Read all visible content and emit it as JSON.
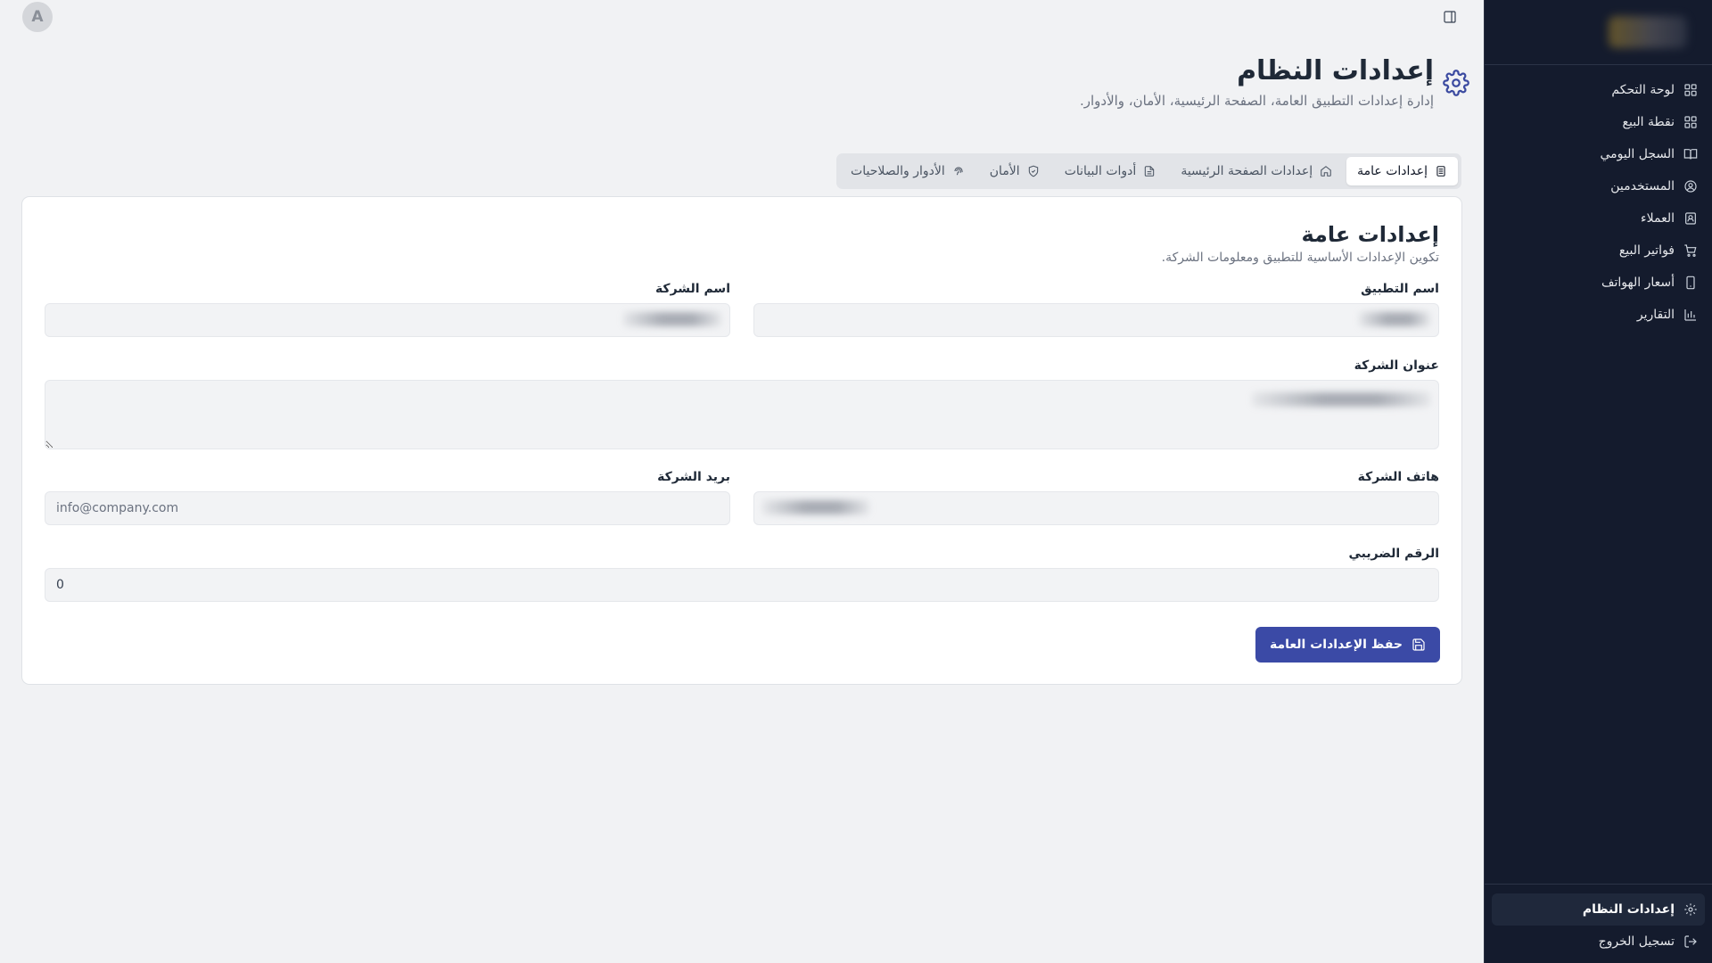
{
  "user": {
    "avatar_initial": "A"
  },
  "page": {
    "title": "إعدادات النظام",
    "subtitle": "إدارة إعدادات التطبيق العامة، الصفحة الرئيسية، الأمان، والأدوار."
  },
  "tabs": [
    {
      "label": "إعدادات عامة",
      "icon": "file-icon",
      "active": true
    },
    {
      "label": "إعدادات الصفحة الرئيسية",
      "icon": "home-icon",
      "active": false
    },
    {
      "label": "أدوات البيانات",
      "icon": "document-icon",
      "active": false
    },
    {
      "label": "الأمان",
      "icon": "shield-icon",
      "active": false
    },
    {
      "label": "الأدوار والصلاحيات",
      "icon": "fingerprint-icon",
      "active": false
    }
  ],
  "card": {
    "title": "إعدادات عامة",
    "description": "تكوين الإعدادات الأساسية للتطبيق ومعلومات الشركة."
  },
  "fields": {
    "app_name": {
      "label": "اسم التطبيق",
      "value": ""
    },
    "company_name": {
      "label": "اسم الشركة",
      "value": ""
    },
    "company_address": {
      "label": "عنوان الشركة",
      "value": ""
    },
    "company_phone": {
      "label": "هاتف الشركة",
      "value": ""
    },
    "company_email": {
      "label": "بريد الشركة",
      "value": "",
      "placeholder": "info@company.com"
    },
    "tax_number": {
      "label": "الرقم الضريبي",
      "value": "0"
    }
  },
  "save_button": {
    "label": "حفظ الإعدادات العامة"
  },
  "sidebar": {
    "items": [
      {
        "label": "لوحة التحكم",
        "icon": "grid-icon"
      },
      {
        "label": "نقطة البيع",
        "icon": "grid-icon"
      },
      {
        "label": "السجل اليومي",
        "icon": "book-icon"
      },
      {
        "label": "المستخدمين",
        "icon": "user-circle-icon"
      },
      {
        "label": "العملاء",
        "icon": "contact-icon"
      },
      {
        "label": "فواتير البيع",
        "icon": "cart-icon"
      },
      {
        "label": "أسعار الهواتف",
        "icon": "phone-icon"
      },
      {
        "label": "التقارير",
        "icon": "bar-chart-icon"
      }
    ],
    "footer": [
      {
        "label": "إعدادات النظام",
        "icon": "gear-icon",
        "active": true
      },
      {
        "label": "تسجيل الخروج",
        "icon": "logout-icon",
        "active": false
      }
    ]
  },
  "colors": {
    "primary": "#3b4aa6",
    "sidebar_bg": "#141b2d",
    "page_bg": "#f1f2f4"
  }
}
